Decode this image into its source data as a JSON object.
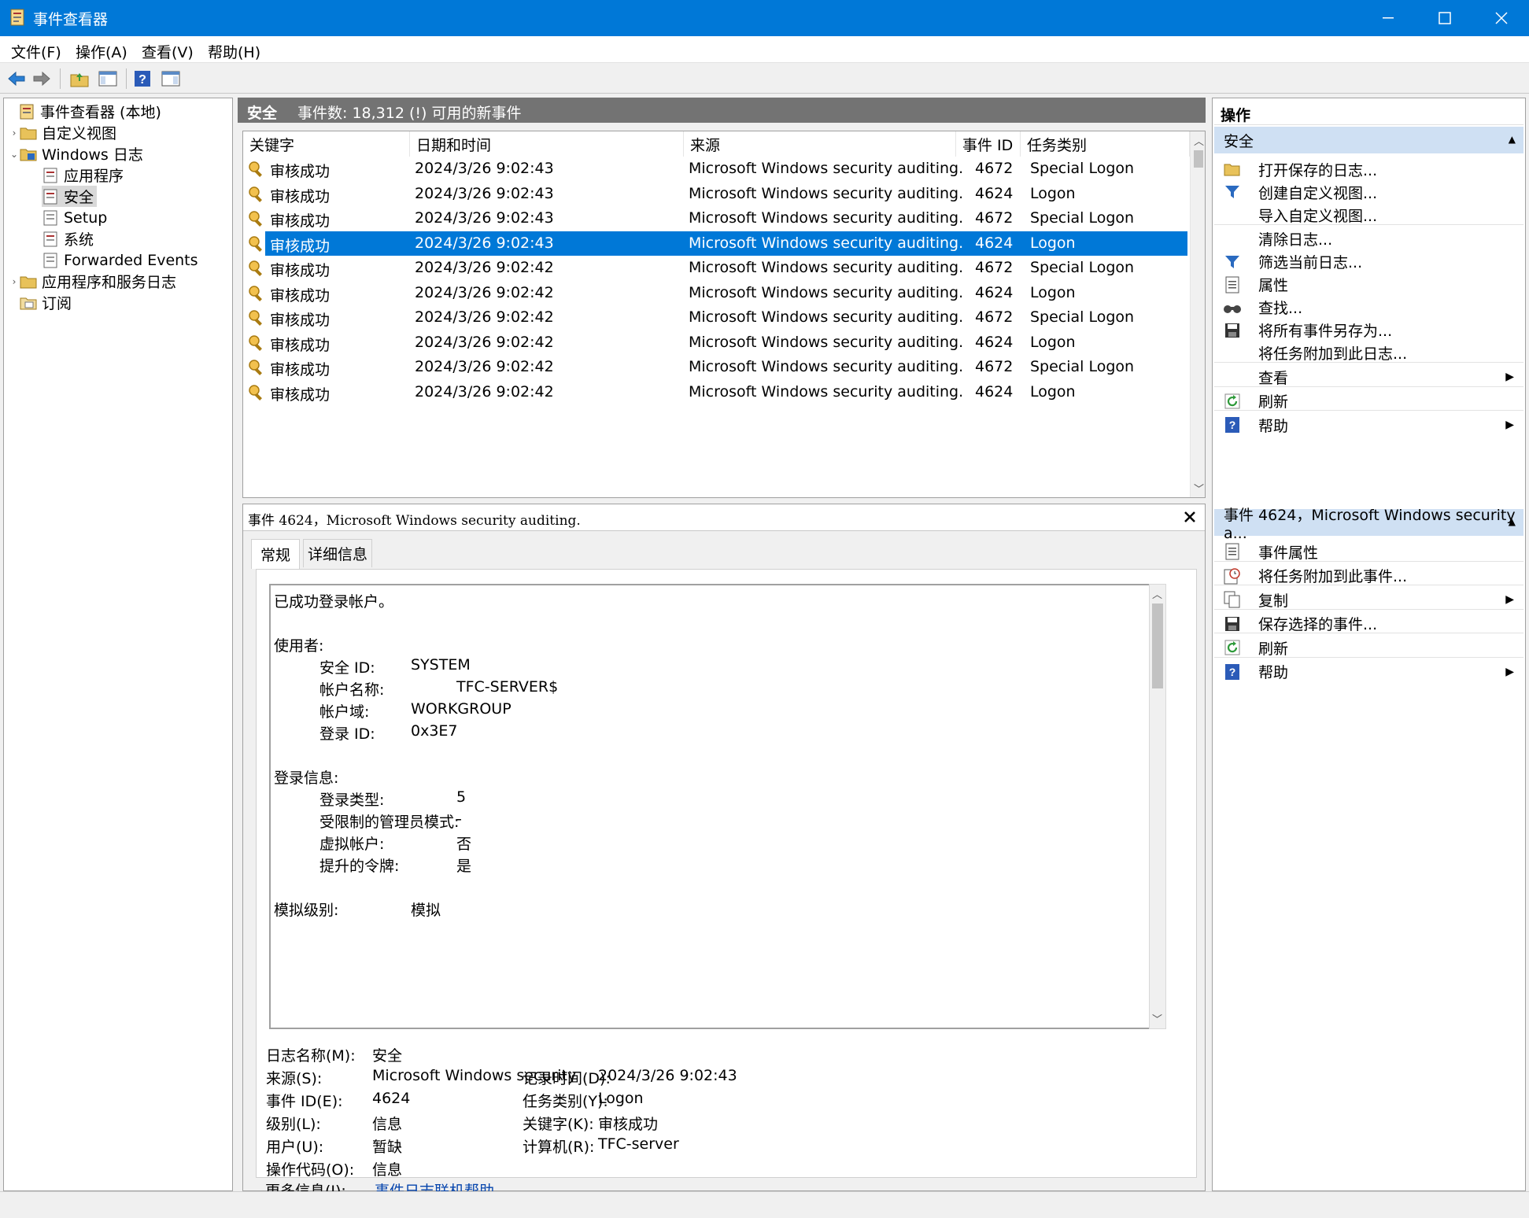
{
  "window": {
    "title": "事件查看器"
  },
  "menu": [
    "文件(F)",
    "操作(A)",
    "查看(V)",
    "帮助(H)"
  ],
  "toolbar": [
    "back-icon",
    "forward-icon",
    "up-folder-icon",
    "show-hide-tree-icon",
    "help-icon",
    "show-action-pane-icon"
  ],
  "tree": {
    "root": "事件查看器 (本地)",
    "custom_views": "自定义视图",
    "windows_logs": "Windows 日志",
    "application": "应用程序",
    "security": "安全",
    "setup": "Setup",
    "system": "系统",
    "forwarded": "Forwarded Events",
    "app_service_logs": "应用程序和服务日志",
    "subscriptions": "订阅"
  },
  "center_header": {
    "title": "安全",
    "count": "事件数: 18,312 (!) 可用的新事件"
  },
  "columns": [
    "关键字",
    "日期和时间",
    "来源",
    "事件 ID",
    "任务类别"
  ],
  "events": [
    {
      "keyword": "审核成功",
      "datetime": "2024/3/26 9:02:43",
      "source": "Microsoft Windows security auditing.",
      "id": "4672",
      "task": "Special Logon"
    },
    {
      "keyword": "审核成功",
      "datetime": "2024/3/26 9:02:43",
      "source": "Microsoft Windows security auditing.",
      "id": "4624",
      "task": "Logon"
    },
    {
      "keyword": "审核成功",
      "datetime": "2024/3/26 9:02:43",
      "source": "Microsoft Windows security auditing.",
      "id": "4672",
      "task": "Special Logon"
    },
    {
      "keyword": "审核成功",
      "datetime": "2024/3/26 9:02:43",
      "source": "Microsoft Windows security auditing.",
      "id": "4624",
      "task": "Logon",
      "selected": true
    },
    {
      "keyword": "审核成功",
      "datetime": "2024/3/26 9:02:42",
      "source": "Microsoft Windows security auditing.",
      "id": "4672",
      "task": "Special Logon"
    },
    {
      "keyword": "审核成功",
      "datetime": "2024/3/26 9:02:42",
      "source": "Microsoft Windows security auditing.",
      "id": "4624",
      "task": "Logon"
    },
    {
      "keyword": "审核成功",
      "datetime": "2024/3/26 9:02:42",
      "source": "Microsoft Windows security auditing.",
      "id": "4672",
      "task": "Special Logon"
    },
    {
      "keyword": "审核成功",
      "datetime": "2024/3/26 9:02:42",
      "source": "Microsoft Windows security auditing.",
      "id": "4624",
      "task": "Logon"
    },
    {
      "keyword": "审核成功",
      "datetime": "2024/3/26 9:02:42",
      "source": "Microsoft Windows security auditing.",
      "id": "4672",
      "task": "Special Logon"
    },
    {
      "keyword": "审核成功",
      "datetime": "2024/3/26 9:02:42",
      "source": "Microsoft Windows security auditing.",
      "id": "4624",
      "task": "Logon"
    }
  ],
  "detail": {
    "header": "事件 4624，Microsoft Windows security auditing.",
    "tabs": [
      "常规",
      "详细信息"
    ],
    "description": {
      "line1": "已成功登录帐户。",
      "subject_label": "使用者:",
      "sid_label": "安全 ID:",
      "sid_value": "SYSTEM",
      "account_label": "帐户名称:",
      "account_value": "TFC-SERVER$",
      "domain_label": "帐户域:",
      "domain_value": "WORKGROUP",
      "logon_id_label": "登录 ID:",
      "logon_id_value": "0x3E7",
      "logon_info_label": "登录信息:",
      "logon_type_label": "登录类型:",
      "logon_type_value": "5",
      "restricted_label": "受限制的管理员模式:",
      "restricted_value": "-",
      "virtual_label": "虚拟帐户:",
      "virtual_value": "否",
      "elevated_label": "提升的令牌:",
      "elevated_value": "是",
      "impersonation_label": "模拟级别:",
      "impersonation_value": "模拟"
    },
    "fields": {
      "log_name_label": "日志名称(M):",
      "log_name": "安全",
      "source_label": "来源(S):",
      "source": "Microsoft Windows security",
      "logged_label": "记录时间(D):",
      "logged": "2024/3/26 9:02:43",
      "event_id_label": "事件 ID(E):",
      "event_id": "4624",
      "task_label": "任务类别(Y):",
      "task": "Logon",
      "level_label": "级别(L):",
      "level": "信息",
      "keywords_label": "关键字(K):",
      "keywords": "审核成功",
      "user_label": "用户(U):",
      "user": "暂缺",
      "computer_label": "计算机(R):",
      "computer": "TFC-server",
      "opcode_label": "操作代码(O):",
      "opcode": "信息",
      "more_info_label": "更多信息(I):",
      "more_info_link": "事件日志联机帮助"
    }
  },
  "actions": {
    "title": "操作",
    "section1": "安全",
    "items1": [
      "打开保存的日志...",
      "创建自定义视图...",
      "导入自定义视图...",
      "清除日志...",
      "筛选当前日志...",
      "属性",
      "查找...",
      "将所有事件另存为...",
      "将任务附加到此日志...",
      "查看",
      "刷新",
      "帮助"
    ],
    "section2": "事件 4624，Microsoft Windows security a...",
    "items2": [
      "事件属性",
      "将任务附加到此事件...",
      "复制",
      "保存选择的事件...",
      "刷新",
      "帮助"
    ]
  },
  "colors": {
    "accent": "#0078d7",
    "header_gray": "#737373",
    "section_blue": "#cfe0f3"
  }
}
